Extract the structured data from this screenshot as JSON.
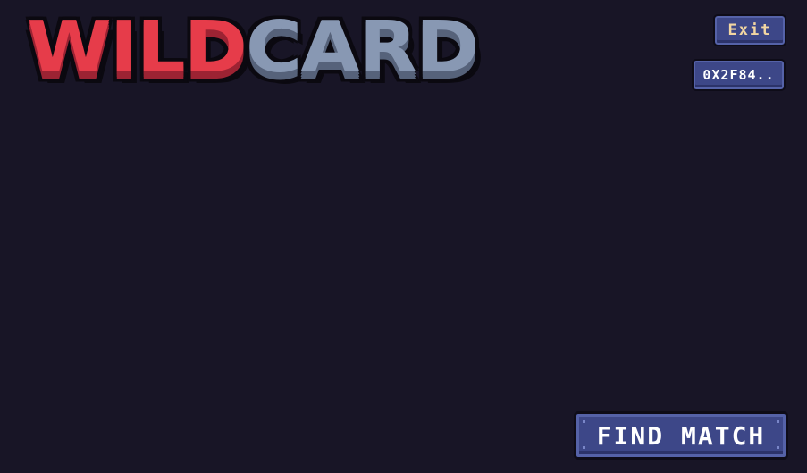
{
  "logo": {
    "part1": "WILD",
    "part2": "CARD"
  },
  "header": {
    "exit_label": "Exit",
    "wallet_label": "0X2F84.."
  },
  "footer": {
    "find_match_label": "FIND MATCH"
  },
  "colors": {
    "background": "#181526",
    "logo_primary": "#e63c4a",
    "logo_secondary": "#8898b3",
    "button_fill": "#3d4788",
    "exit_text": "#f2d6a2"
  }
}
